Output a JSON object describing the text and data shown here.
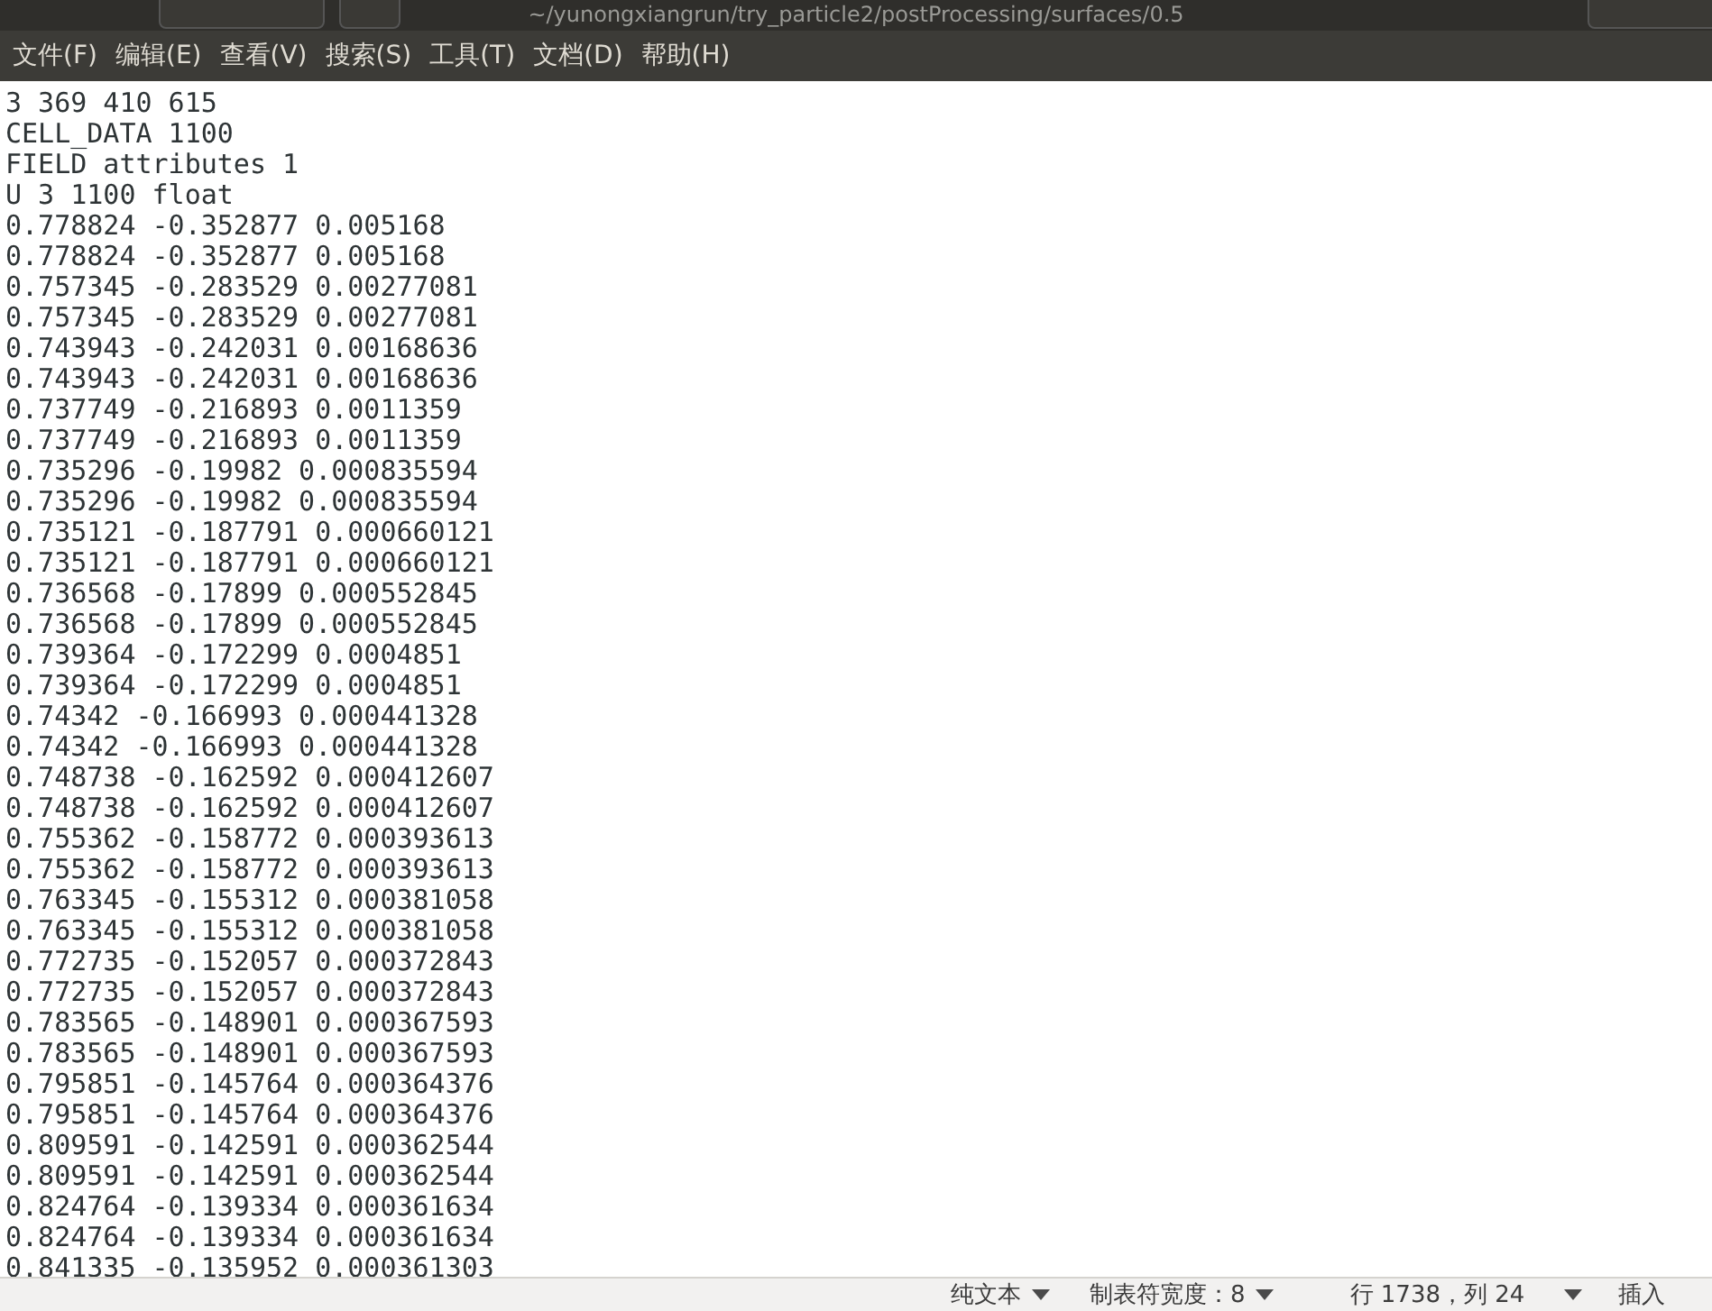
{
  "window": {
    "title": "~/yunongxiangrun/try_particle2/postProcessing/surfaces/0.5"
  },
  "menu": [
    "文件(F)",
    "编辑(E)",
    "查看(V)",
    "搜索(S)",
    "工具(T)",
    "文档(D)",
    "帮助(H)"
  ],
  "editor": {
    "lines": [
      "3 369 410 615",
      "CELL_DATA 1100",
      "FIELD attributes 1",
      "U 3 1100 float",
      "0.778824 -0.352877 0.005168",
      "0.778824 -0.352877 0.005168",
      "0.757345 -0.283529 0.00277081",
      "0.757345 -0.283529 0.00277081",
      "0.743943 -0.242031 0.00168636",
      "0.743943 -0.242031 0.00168636",
      "0.737749 -0.216893 0.0011359",
      "0.737749 -0.216893 0.0011359",
      "0.735296 -0.19982 0.000835594",
      "0.735296 -0.19982 0.000835594",
      "0.735121 -0.187791 0.000660121",
      "0.735121 -0.187791 0.000660121",
      "0.736568 -0.17899 0.000552845",
      "0.736568 -0.17899 0.000552845",
      "0.739364 -0.172299 0.0004851",
      "0.739364 -0.172299 0.0004851",
      "0.74342 -0.166993 0.000441328",
      "0.74342 -0.166993 0.000441328",
      "0.748738 -0.162592 0.000412607",
      "0.748738 -0.162592 0.000412607",
      "0.755362 -0.158772 0.000393613",
      "0.755362 -0.158772 0.000393613",
      "0.763345 -0.155312 0.000381058",
      "0.763345 -0.155312 0.000381058",
      "0.772735 -0.152057 0.000372843",
      "0.772735 -0.152057 0.000372843",
      "0.783565 -0.148901 0.000367593",
      "0.783565 -0.148901 0.000367593",
      "0.795851 -0.145764 0.000364376",
      "0.795851 -0.145764 0.000364376",
      "0.809591 -0.142591 0.000362544",
      "0.809591 -0.142591 0.000362544",
      "0.824764 -0.139334 0.000361634",
      "0.824764 -0.139334 0.000361634",
      "0.841335 -0.135952 0.000361303"
    ]
  },
  "status_bar": {
    "language": "纯文本",
    "tab_width": "制表符宽度：8",
    "position": "行 1738，列 24",
    "mode": "插入"
  }
}
